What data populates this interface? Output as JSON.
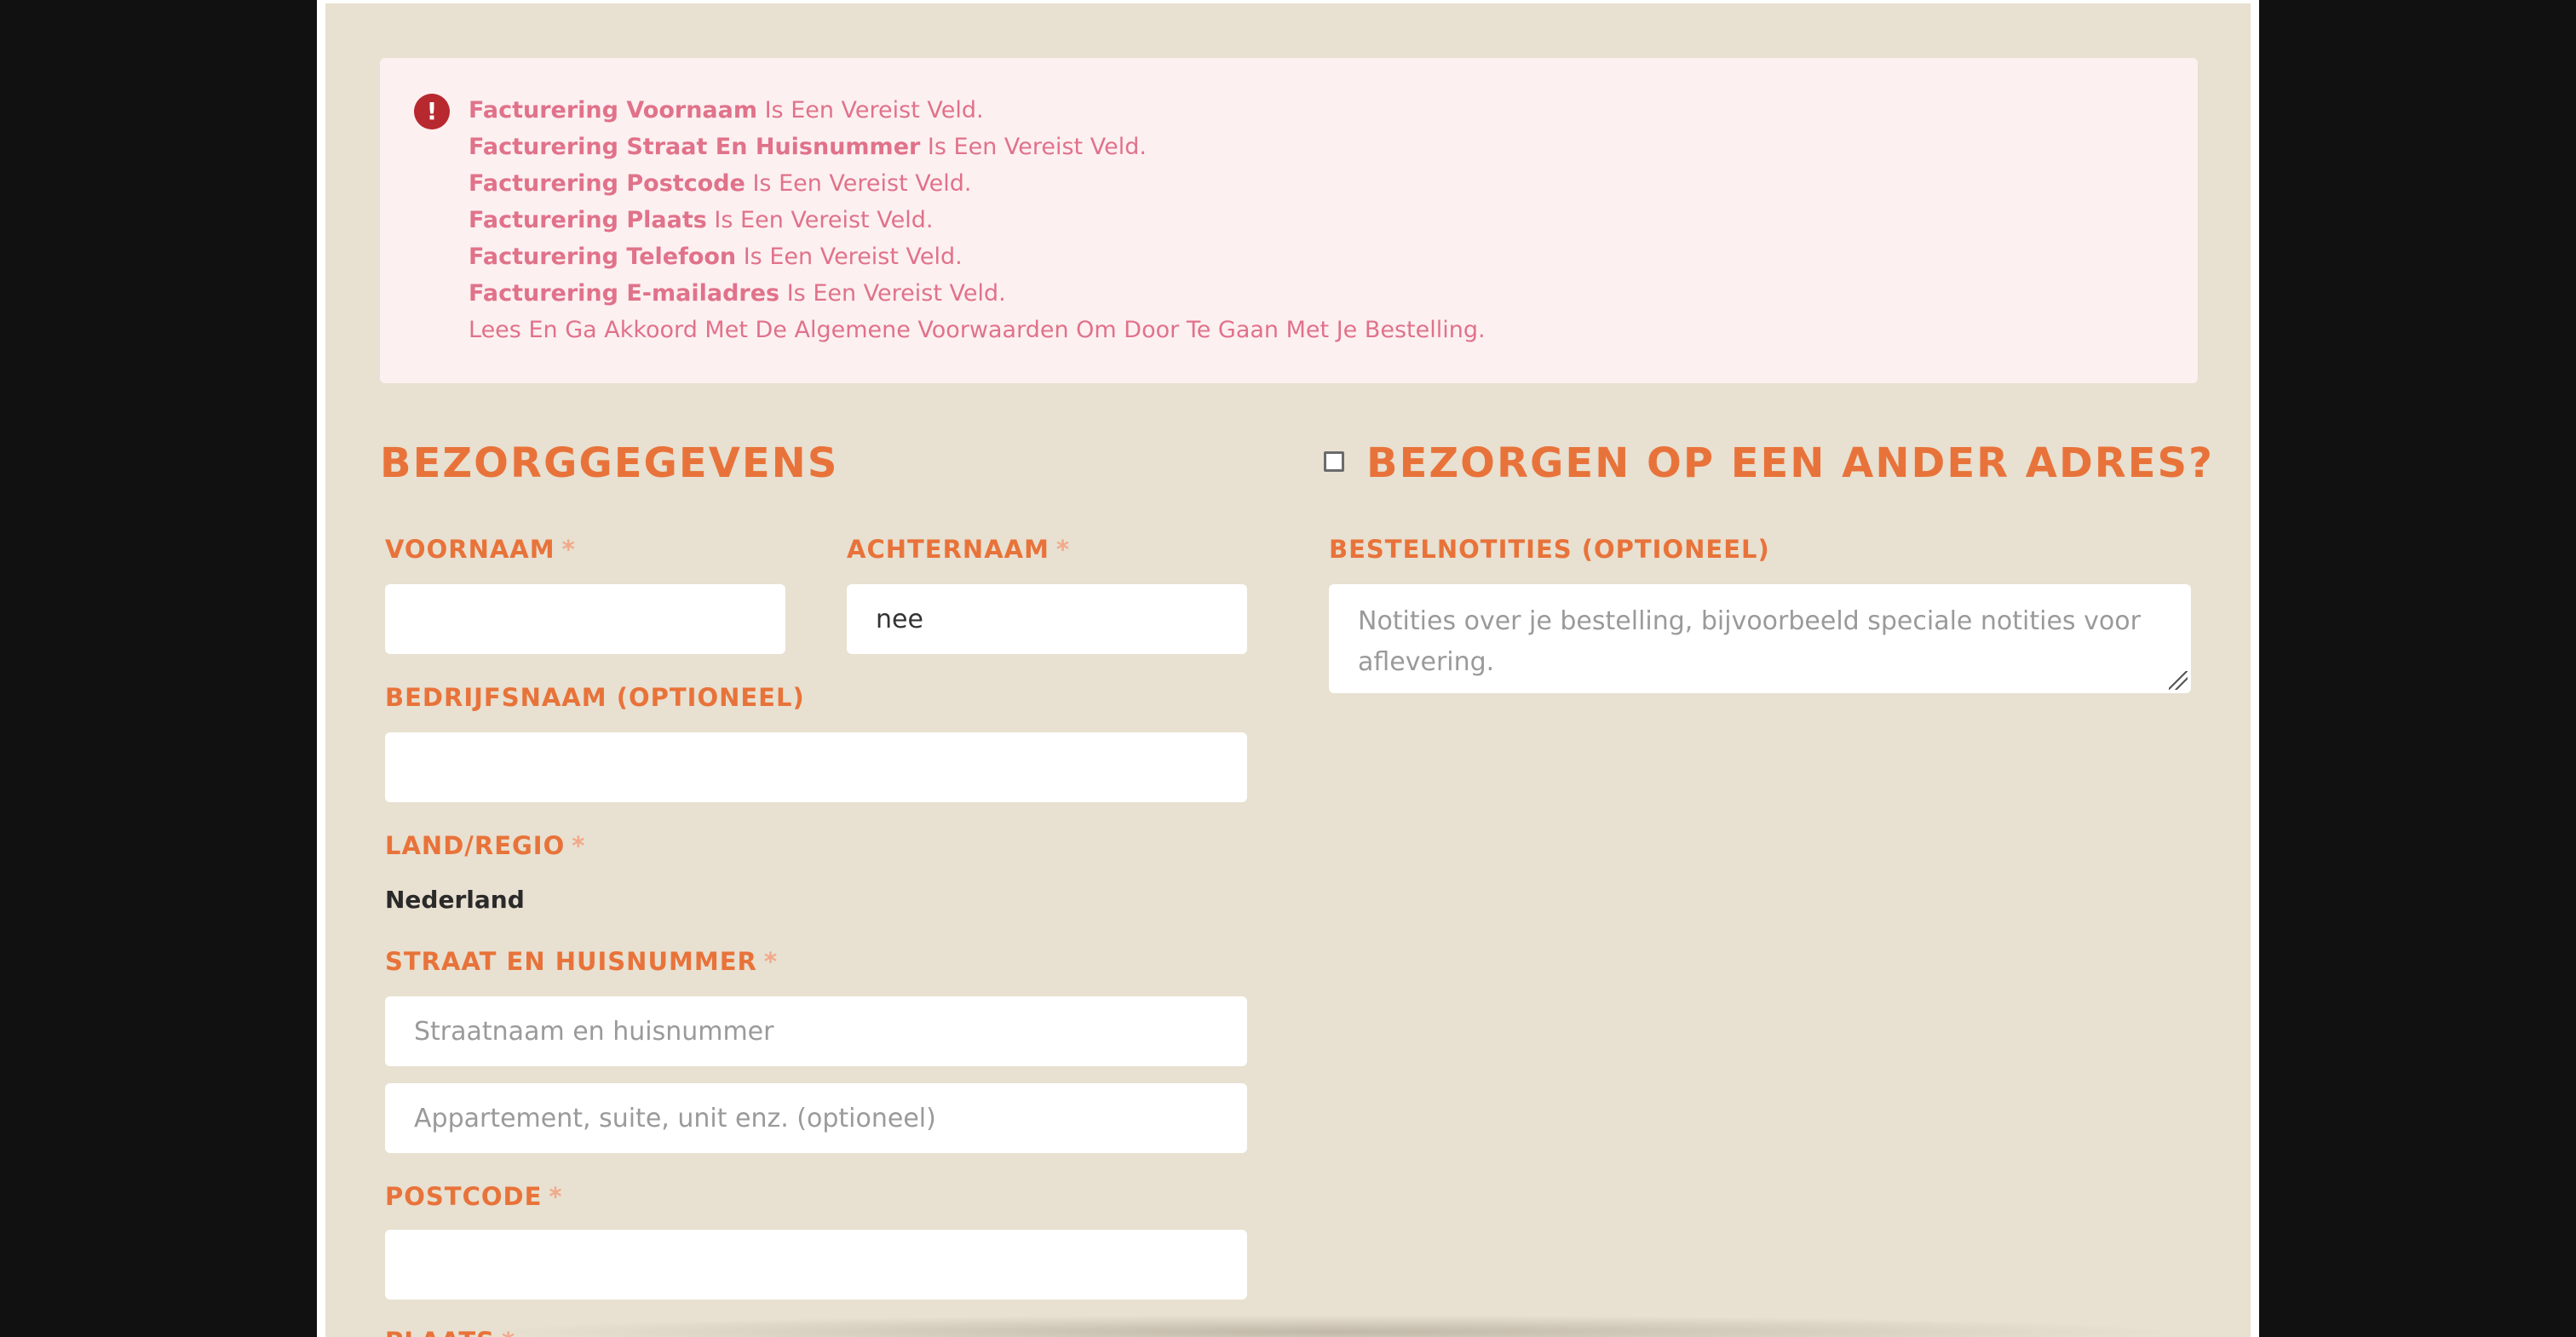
{
  "notice": {
    "icon": "error-exclamation-icon",
    "messages": [
      {
        "strong": "Facturering Voornaam",
        "rest": " Is Een Vereist Veld."
      },
      {
        "strong": "Facturering Straat En Huisnummer",
        "rest": " Is Een Vereist Veld."
      },
      {
        "strong": "Facturering Postcode",
        "rest": " Is Een Vereist Veld."
      },
      {
        "strong": "Facturering Plaats",
        "rest": " Is Een Vereist Veld."
      },
      {
        "strong": "Facturering Telefoon",
        "rest": " Is Een Vereist Veld."
      },
      {
        "strong": "Facturering E-mailadres",
        "rest": " Is Een Vereist Veld."
      },
      {
        "strong": "",
        "rest": "Lees En Ga Akkoord Met De Algemene Voorwaarden Om Door Te Gaan Met Je Bestelling."
      }
    ]
  },
  "billing": {
    "title": "Bezorggegevens",
    "first_name": {
      "label": "Voornaam",
      "value": "",
      "required": "*"
    },
    "last_name": {
      "label": "Achternaam",
      "value": "nee",
      "required": "*"
    },
    "company": {
      "label": "Bedrijfsnaam (optioneel)",
      "value": ""
    },
    "country": {
      "label": "Land/regio",
      "value": "Nederland",
      "required": "*"
    },
    "street": {
      "label": "Straat en huisnummer",
      "placeholder": "Straatnaam en huisnummer",
      "required": "*"
    },
    "street2": {
      "placeholder": "Appartement, suite, unit enz. (optioneel)"
    },
    "postcode": {
      "label": "Postcode",
      "value": "",
      "required": "*"
    },
    "city": {
      "label": "Plaats",
      "required": "*"
    }
  },
  "shipping": {
    "title": "Bezorgen op een ander adres?",
    "checked": false,
    "notes": {
      "label": "Bestelnotities (optioneel)",
      "placeholder": "Notities over je bestelling, bijvoorbeeld speciale notities voor aflevering."
    }
  },
  "colors": {
    "accent": "#e8733a",
    "background": "#e8e0d0",
    "notice_bg": "#fdf0f1",
    "notice_text": "#e0728a",
    "error_icon": "#b8282f"
  }
}
